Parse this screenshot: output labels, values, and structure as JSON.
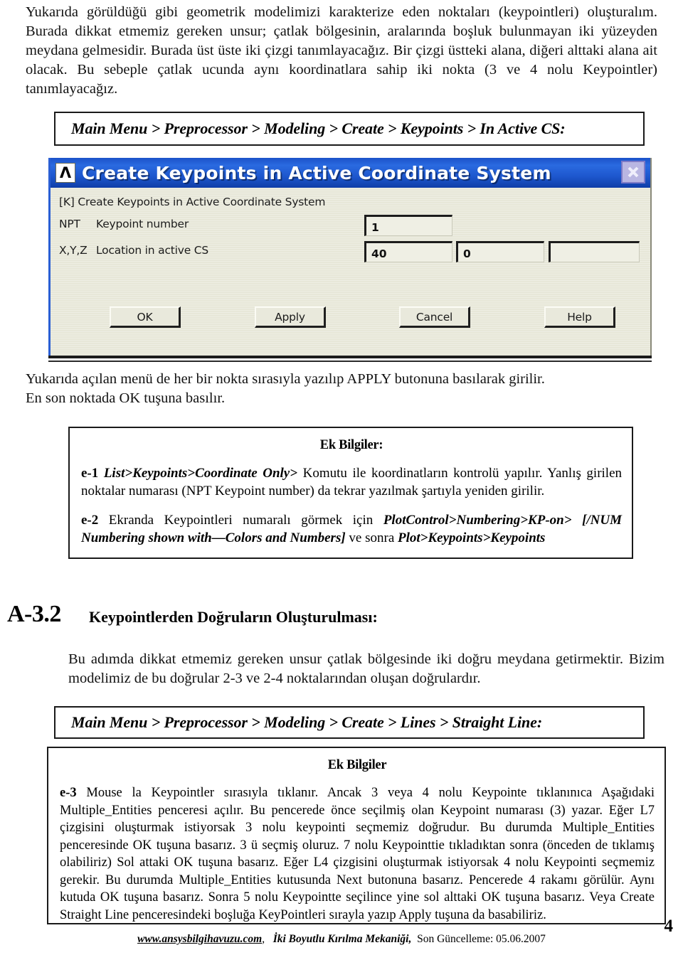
{
  "intro": {
    "paragraph": "Yukarıda görüldüğü gibi geometrik modelimizi karakterize eden noktaları (keypointleri) oluşturalım. Burada dikkat etmemiz gereken unsur; çatlak bölgesinin, aralarında boşluk bulunmayan iki yüzeyden meydana gelmesidir. Burada üst üste iki çizgi tanımlayacağız. Bir çizgi üstteki alana, diğeri alttaki alana ait olacak. Bu sebeple çatlak ucunda aynı koordinatlara sahip iki nokta (3 ve 4 nolu Keypointler) tanımlayacağız."
  },
  "menu_path_1": {
    "text": "Main Menu > Preprocessor  > Modeling > Create  > Keypoints > In Active CS:"
  },
  "dialog": {
    "logo_glyph": "Λ",
    "title": "Create Keypoints in Active Coordinate System",
    "close_icon": "close-icon",
    "command_label": "[K]  Create Keypoints in Active Coordinate System",
    "fields": [
      {
        "code": "NPT",
        "label": "Keypoint number",
        "inputs": [
          {
            "value": "1",
            "placeholder": ""
          }
        ]
      },
      {
        "code": "X,Y,Z",
        "label": "Location in active CS",
        "inputs": [
          {
            "value": "40",
            "placeholder": ""
          },
          {
            "value": "0",
            "placeholder": ""
          },
          {
            "value": "",
            "placeholder": ""
          }
        ]
      }
    ],
    "buttons": [
      {
        "label": "OK"
      },
      {
        "label": "Apply"
      },
      {
        "label": "Cancel"
      },
      {
        "label": "Help"
      }
    ],
    "colors": {
      "titlebar": "#1e58cf",
      "body": "#e7e7d8",
      "close_button": "#b9b6e2"
    }
  },
  "after_dialog": {
    "line1": "Yukarıda açılan menü de her bir nokta sırasıyla yazılıp APPLY butonuna basılarak girilir.",
    "line2": "En son noktada OK tuşuna basılır."
  },
  "info_box_1": {
    "title": "Ek Bilgiler:",
    "items": [
      {
        "tag": "e-1",
        "emph1": "List>Keypoints>Coordinate Only>",
        "rest": "Komutu ile  koordinatların kontrolü yapılır. Yanlış girilen noktalar numarası (NPT Keypoint number) da tekrar yazılmak şartıyla yeniden girilir."
      },
      {
        "tag": "e-2",
        "mid1": "Ekranda Keypointleri numaralı görmek için",
        "emph1": "PlotControl>Numbering>KP-on>  [/NUM Numbering shown with—Colors and Numbers]",
        "mid2": "ve sonra",
        "emph2": "Plot>Keypoints>Keypoints"
      }
    ]
  },
  "section": {
    "number": "A-3.2",
    "title": "Keypointlerden Doğruların Oluşturulması:",
    "paragraph": "Bu adımda dikkat etmemiz gereken unsur çatlak bölgesinde iki doğru meydana getirmektir. Bizim modelimiz de bu doğrular 2-3 ve 2-4  noktalarından oluşan doğrulardır."
  },
  "menu_path_2": {
    "text": "Main Menu > Preprocessor > Modeling > Create > Lines > Straight Line:"
  },
  "info_box_2": {
    "title": "Ek Bilgiler",
    "items": [
      {
        "tag": "e-3",
        "rest": "Mouse la Keypointler sırasıyla tıklanır.   Ancak 3 veya 4 nolu Keypointe tıklanınıca Aşağıdaki Multiple_Entities penceresi açılır. Bu pencerede önce seçilmiş olan Keypoint numarası (3) yazar.  Eğer L7 çizgisini oluşturmak istiyorsak 3 nolu keypointi seçmemiz doğrudur. Bu durumda Multiple_Entities penceresinde OK tuşuna basarız. 3 ü seçmiş oluruz. 7 nolu Keypointtie tıkladıktan sonra (önceden de tıklamış olabiliriz) Sol attaki OK tuşuna basarız. Eğer L4 çizgisini oluşturmak istiyorsak 4 nolu Keypointi seçmemiz gerekir. Bu durumda Multiple_Entities kutusunda Next butonuna basarız. Pencerede 4 rakamı görülür. Aynı kutuda OK tuşuna basarız. Sonra 5 nolu Keypointte seçilince yine sol alttaki OK tuşuna basarız. Veya Create Straight Line penceresindeki boşluğa KeyPointleri sırayla yazıp Apply tuşuna da basabiliriz."
      }
    ]
  },
  "footer": {
    "url": "www.ansysbilgihavuzu.com",
    "separator": ",",
    "doc_title": "İki Boyutlu Kırılma Mekaniği,",
    "updated": "Son Güncelleme: 05.06.2007",
    "page_number": "4"
  }
}
